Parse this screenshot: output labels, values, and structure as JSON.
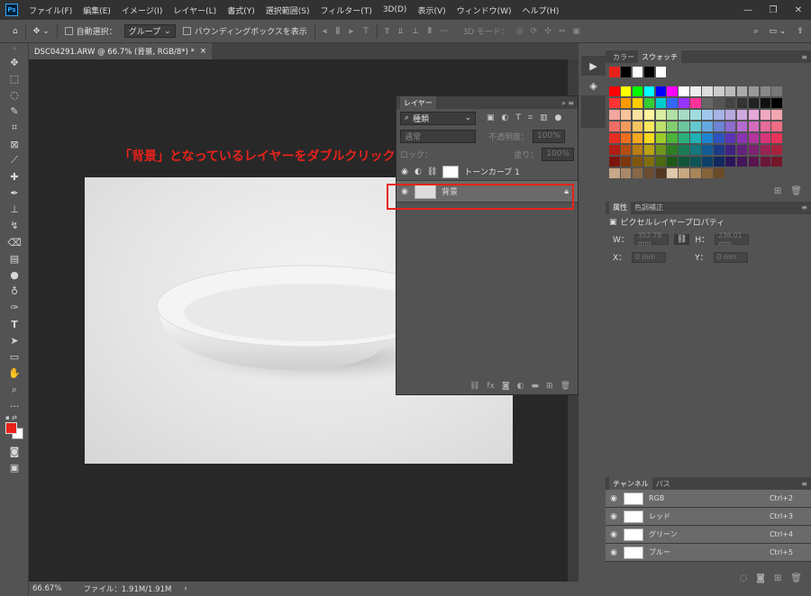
{
  "menu": {
    "items": [
      "ファイル(F)",
      "編集(E)",
      "イメージ(I)",
      "レイヤー(L)",
      "書式(Y)",
      "選択範囲(S)",
      "フィルター(T)",
      "3D(D)",
      "表示(V)",
      "ウィンドウ(W)",
      "ヘルプ(H)"
    ]
  },
  "options": {
    "auto_select": "自動選択：",
    "group": "グループ",
    "bounding": "バウンディングボックスを表示",
    "mode3d": "3D モード："
  },
  "document": {
    "tab": "DSC04291.ARW @ 66.7% (背景, RGB/8*) *",
    "zoom": "66.67%",
    "file_info": "ファイル：1.91M/1.91M"
  },
  "annotation": "「背景」となっているレイヤーをダブルクリック",
  "layers": {
    "title": "レイヤー",
    "filter": "種類",
    "blend": "通常",
    "opacity_label": "不透明度：",
    "opacity": "100%",
    "lock_label": "ロック：",
    "fill_label": "塗り：",
    "fill": "100%",
    "items": [
      {
        "name": "トーンカーブ 1"
      },
      {
        "name": "背景"
      }
    ]
  },
  "color": {
    "tab_color": "カラー",
    "tab_swatch": "スウォッチ"
  },
  "properties": {
    "tab": "属性",
    "tab2": "色調補正",
    "title": "ピクセルレイヤープロパティ",
    "w_label": "W：",
    "w": "352.78 mm",
    "h_label": "H：",
    "h": "236.01 mm",
    "x_label": "X：",
    "x": "0 mm",
    "y_label": "Y：",
    "y": "0 mm"
  },
  "channels": {
    "tab": "チャンネル",
    "tab2": "パス",
    "items": [
      {
        "name": "RGB",
        "shortcut": "Ctrl+2"
      },
      {
        "name": "レッド",
        "shortcut": "Ctrl+3"
      },
      {
        "name": "グリーン",
        "shortcut": "Ctrl+4"
      },
      {
        "name": "ブルー",
        "shortcut": "Ctrl+5"
      }
    ]
  },
  "colors": {
    "foreground": "#e8221b",
    "background": "#ffffff",
    "highlight": "#e8221b"
  }
}
